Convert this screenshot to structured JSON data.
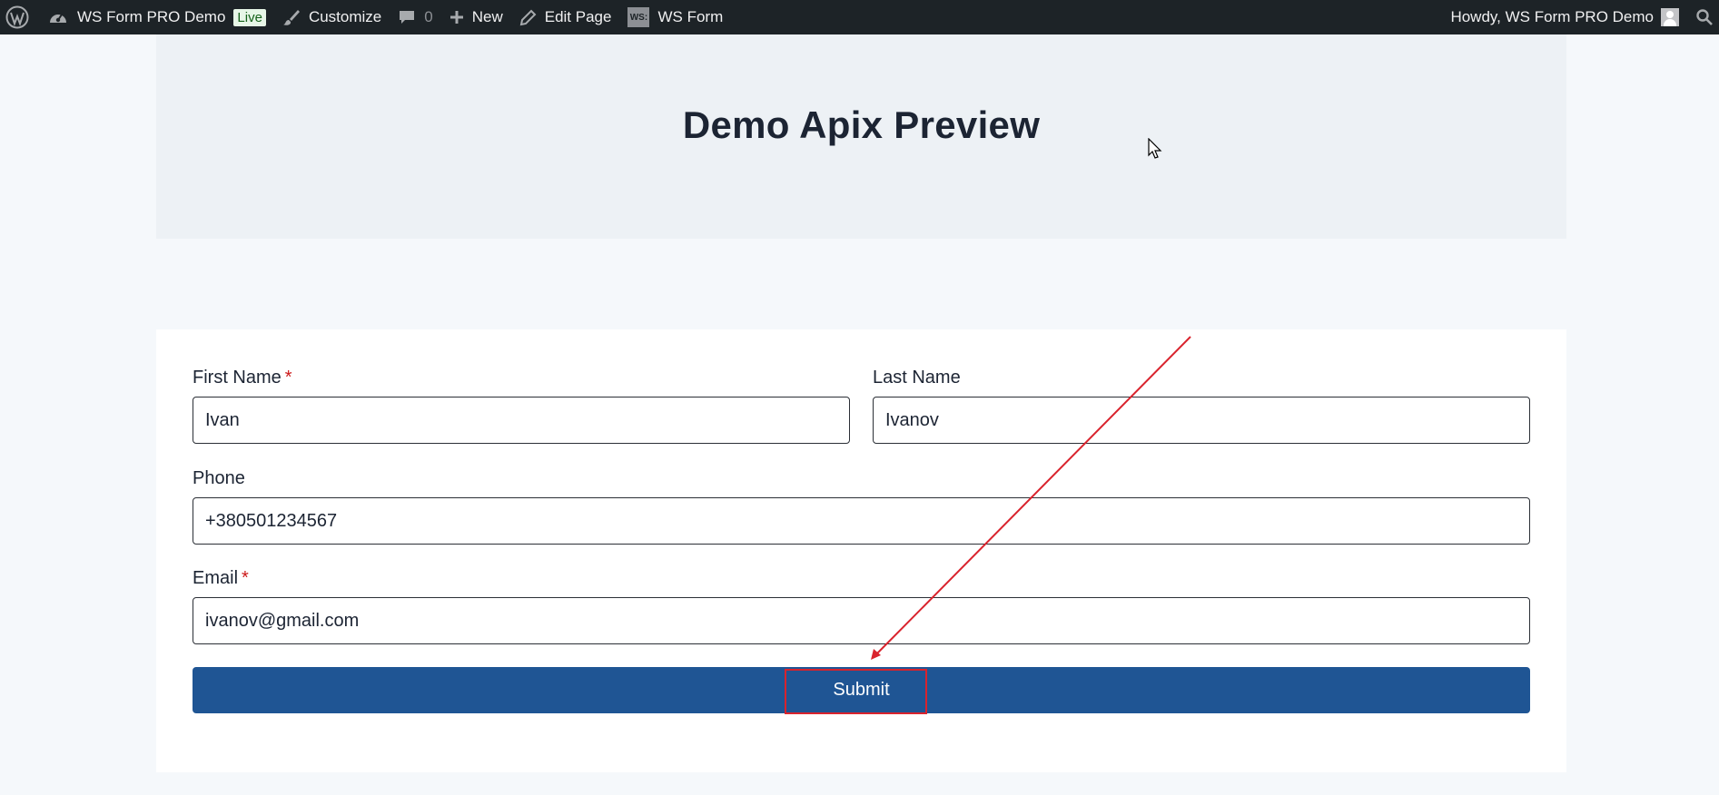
{
  "admin_bar": {
    "site_name": "WS Form PRO Demo",
    "live_badge": "Live",
    "customize": "Customize",
    "comments_count": "0",
    "new": "New",
    "edit_page": "Edit Page",
    "ws_form_logo": "WS:",
    "ws_form": "WS Form",
    "howdy": "Howdy, WS Form PRO Demo"
  },
  "hero": {
    "title": "Demo Apix Preview"
  },
  "form": {
    "first_name": {
      "label": "First Name",
      "required_mark": "*",
      "value": "Ivan"
    },
    "last_name": {
      "label": "Last Name",
      "value": "Ivanov"
    },
    "phone": {
      "label": "Phone",
      "value": "+380501234567"
    },
    "email": {
      "label": "Email",
      "required_mark": "*",
      "value": "ivanov@gmail.com"
    },
    "submit_label": "Submit"
  },
  "colors": {
    "admin_bar_bg": "#1d2327",
    "submit_bg": "#1f5594",
    "required": "#cc1818",
    "annotation": "#d9232d"
  },
  "icons": [
    "wordpress-logo-icon",
    "dashboard-icon",
    "brush-icon",
    "comment-icon",
    "plus-icon",
    "pencil-icon",
    "ws-form-icon",
    "avatar-icon",
    "search-icon",
    "mouse-cursor-icon"
  ]
}
